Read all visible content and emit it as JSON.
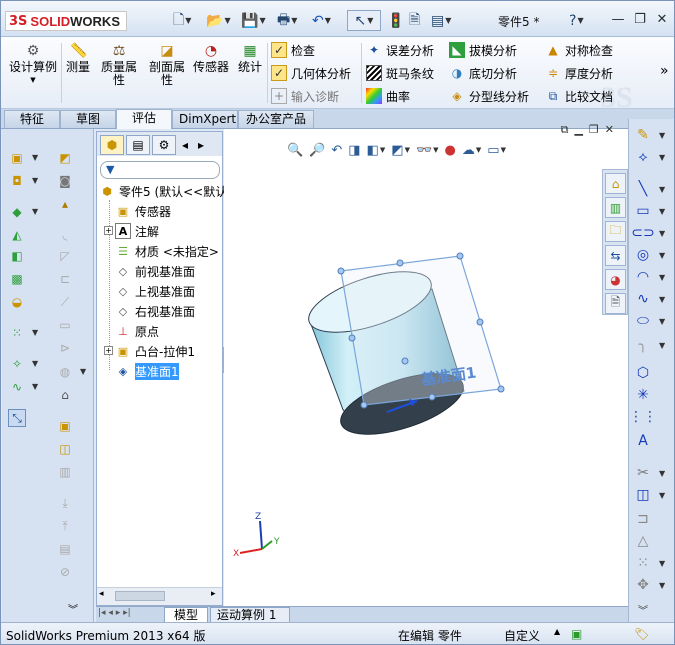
{
  "titlebar": {
    "logo_mark": "3S",
    "logo_text_a": "SOLID",
    "logo_text_b": "WORKS",
    "doc_title": "零件5 *",
    "help_label": "?"
  },
  "ribbon": {
    "design_study": "设计算例",
    "measure": "测量",
    "mass_props": "质量属性",
    "section_props": "剖面属性",
    "sensors": "传感器",
    "statistics": "统计",
    "check": "检查",
    "geometry_analysis": "几何体分析",
    "import_diagnostics": "输入诊断",
    "deviation_analysis": "误差分析",
    "zebra_stripes": "斑马条纹",
    "curvature": "曲率",
    "draft_analysis": "拔模分析",
    "undercut_analysis": "底切分析",
    "parting_line_analysis": "分型线分析",
    "symmetry_check": "对称检查",
    "thickness_analysis": "厚度分析",
    "compare_documents": "比较文档",
    "more_label": "»"
  },
  "tabs": [
    "特征",
    "草图",
    "评估",
    "DimXpert",
    "办公室产品"
  ],
  "feature_tree": {
    "filter_icon": "filter-icon",
    "root": "零件5 (默认<<默认",
    "items": [
      {
        "label": "传感器",
        "icon": "sensor-folder-icon"
      },
      {
        "label": "注解",
        "icon": "annotations-icon"
      },
      {
        "label": "材质 <未指定>",
        "icon": "material-icon"
      },
      {
        "label": "前视基准面",
        "icon": "plane-icon"
      },
      {
        "label": "上视基准面",
        "icon": "plane-icon"
      },
      {
        "label": "右视基准面",
        "icon": "plane-icon"
      },
      {
        "label": "原点",
        "icon": "origin-icon"
      },
      {
        "label": "凸台-拉伸1",
        "icon": "extrude-icon"
      },
      {
        "label": "基准面1",
        "icon": "plane-icon"
      }
    ]
  },
  "viewport": {
    "plane_label": "基准面1",
    "triad_x": "X",
    "triad_y": "Y",
    "triad_z": "Z"
  },
  "bottom_tabs": [
    "模型",
    "运动算例 1"
  ],
  "status": {
    "product": "SolidWorks Premium 2013 x64 版",
    "mode": "在编辑 零件",
    "units": "自定义"
  },
  "colors": {
    "accent": "#1f4f8f",
    "brand_red": "#d31f26",
    "selection": "#3399ff",
    "plane_outline": "#7aa6dc",
    "cylinder": "#bfe3ef"
  }
}
